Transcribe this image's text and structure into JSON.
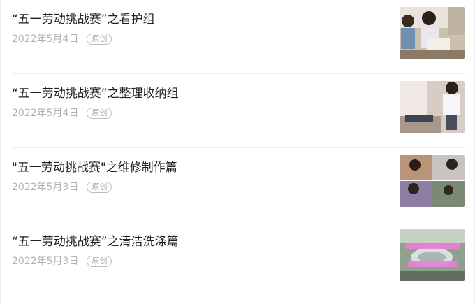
{
  "articles": [
    {
      "title": "“五一劳动挑战赛”之看护组",
      "date": "2022年5月4日",
      "badge": "原创",
      "thumbnail_icon": "photo-kids-caring-icon"
    },
    {
      "title": "“五一劳动挑战赛”之整理收纳组",
      "date": "2022年5月4日",
      "badge": "原创",
      "thumbnail_icon": "photo-kid-organizing-icon"
    },
    {
      "title": "\"五一劳动挑战赛\"之维修制作篇",
      "date": "2022年5月3日",
      "badge": "原创",
      "thumbnail_icon": "photo-collage-repair-icon"
    },
    {
      "title": "“五一劳动挑战赛”之清洁洗涤篇",
      "date": "2022年5月3日",
      "badge": "原创",
      "thumbnail_icon": "photo-washing-dishes-icon"
    }
  ],
  "colors": {
    "title": "#1f1f1f",
    "meta": "#b2b2b2",
    "divider": "#efefef"
  }
}
